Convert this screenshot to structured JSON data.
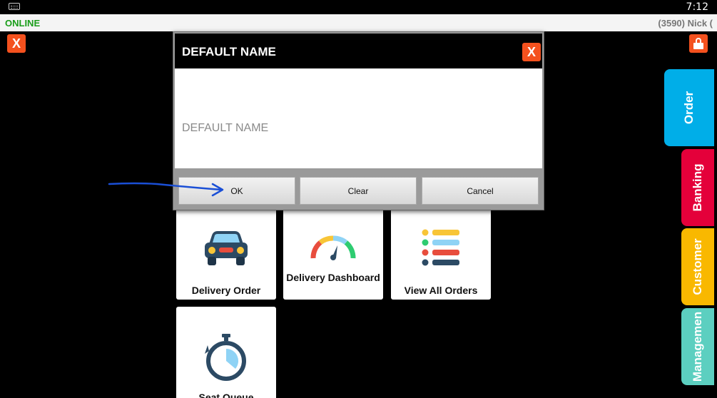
{
  "status_bar": {
    "time": "7:12",
    "keyboard_icon": "keyboard-icon"
  },
  "connection": {
    "status": "ONLINE",
    "user": "(3590) Nick ("
  },
  "header": {
    "close_icon": "close-icon",
    "close_label": "X",
    "lock_icon": "lock-icon"
  },
  "tiles": [
    {
      "label": "Delivery Order",
      "icon": "car-icon"
    },
    {
      "label": "Delivery Dashboard",
      "icon": "gauge-icon"
    },
    {
      "label": "View All Orders",
      "icon": "list-icon"
    },
    {
      "label": "Seat Queue",
      "icon": "stopwatch-icon"
    }
  ],
  "side_tabs": [
    {
      "label": "Order",
      "color": "#00aee8"
    },
    {
      "label": "Banking",
      "color": "#e4003a"
    },
    {
      "label": "Customer",
      "color": "#f9b800"
    },
    {
      "label": "Managemen",
      "color": "#5ccfc0"
    }
  ],
  "dialog": {
    "title": "DEFAULT NAME",
    "close_label": "X",
    "input_value": "",
    "input_placeholder": "DEFAULT NAME",
    "buttons": {
      "ok": "OK",
      "clear": "Clear",
      "cancel": "Cancel"
    }
  },
  "colors": {
    "accent_orange": "#f4511e",
    "online_green": "#1a9d1a",
    "annotation_blue": "#1a4fd6"
  }
}
